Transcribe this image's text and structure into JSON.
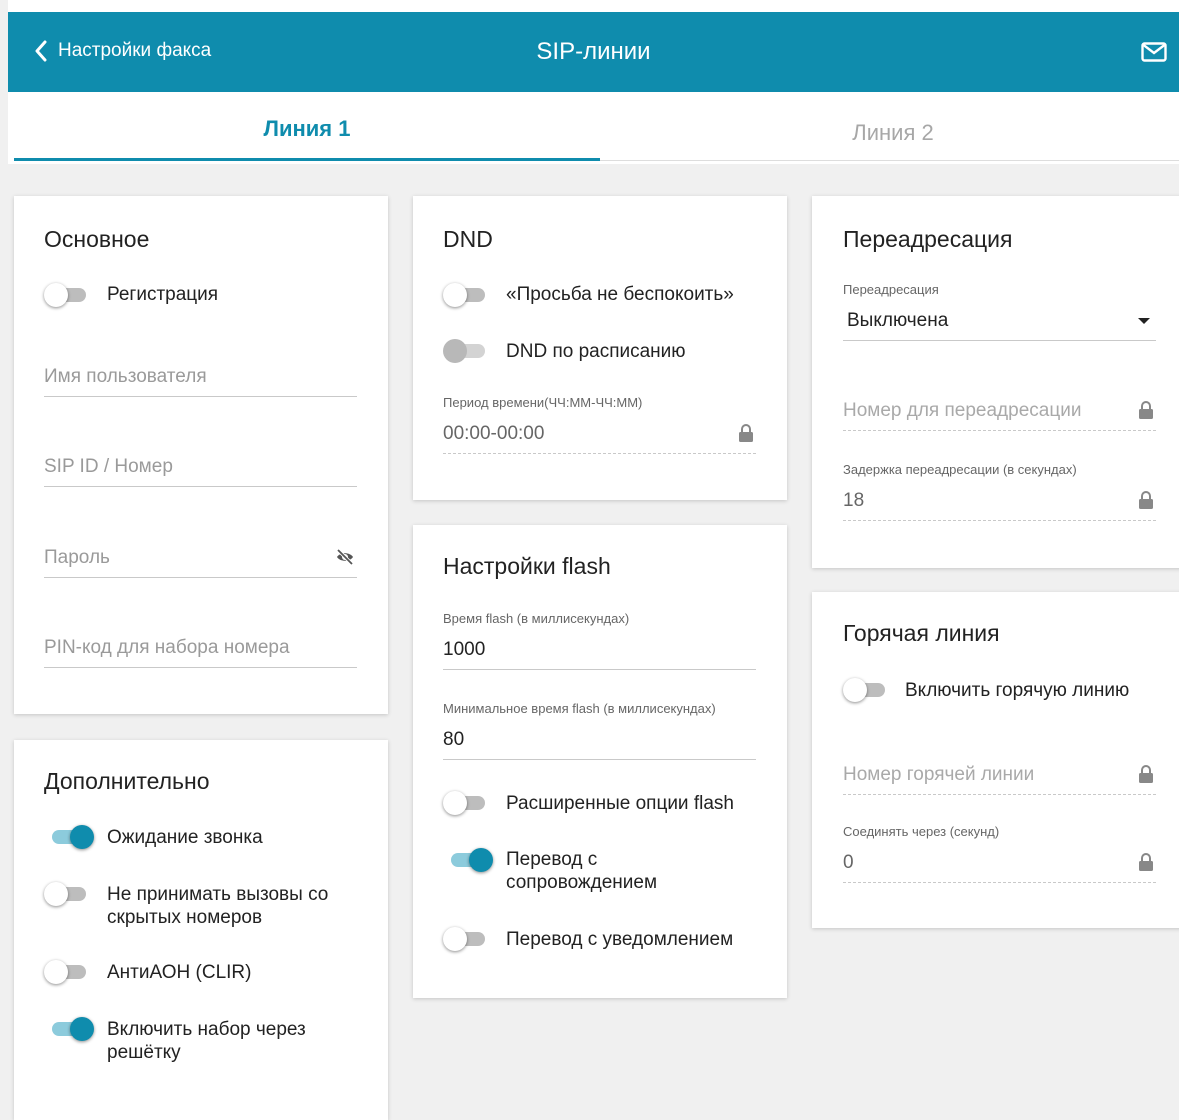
{
  "header": {
    "back_label": "Настройки факса",
    "title": "SIP-линии",
    "accent_color": "#0f8cad"
  },
  "tabs": [
    {
      "label": "Линия 1",
      "active": true
    },
    {
      "label": "Линия 2",
      "active": false
    }
  ],
  "basic": {
    "title": "Основное",
    "registration": {
      "label": "Регистрация",
      "on": false
    },
    "username": {
      "placeholder": "Имя пользователя"
    },
    "sip_id": {
      "placeholder": "SIP ID / Номер"
    },
    "password": {
      "placeholder": "Пароль"
    },
    "pin": {
      "placeholder": "PIN-код для набора номера"
    }
  },
  "extra": {
    "title": "Дополнительно",
    "call_waiting": {
      "label": "Ожидание звонка",
      "on": true
    },
    "reject_hidden": {
      "label_1": "Не принимать вызовы со",
      "label_2": "скрытых номеров",
      "on": false
    },
    "clir": {
      "label": "АнтиАОН (CLIR)",
      "on": false
    },
    "hash_dial": {
      "label_1": "Включить набор через",
      "label_2": "решётку",
      "on": true
    }
  },
  "dnd": {
    "title": "DND",
    "do_not_disturb": {
      "label": "«Просьба не беспокоить»",
      "on": false
    },
    "scheduled": {
      "label": "DND по расписанию",
      "on": false,
      "disabled": true
    },
    "period": {
      "label": "Период времени(ЧЧ:ММ-ЧЧ:ММ)",
      "value": "00:00-00:00"
    }
  },
  "flash": {
    "title": "Настройки flash",
    "time": {
      "label": "Время flash (в миллисекундах)",
      "value": "1000"
    },
    "min_time": {
      "label": "Минимальное время flash (в миллисекундах)",
      "value": "80"
    },
    "extended": {
      "label": "Расширенные опции flash",
      "on": false
    },
    "attended": {
      "label_1": "Перевод с",
      "label_2": "сопровождением",
      "on": true
    },
    "notify": {
      "label": "Перевод с уведомлением",
      "on": false
    }
  },
  "forward": {
    "title": "Переадресация",
    "mode": {
      "label": "Переадресация",
      "value": "Выключена"
    },
    "number": {
      "placeholder": "Номер для переадресации"
    },
    "delay": {
      "label": "Задержка переадресации (в секундах)",
      "value": "18"
    }
  },
  "hotline": {
    "title": "Горячая линия",
    "enable": {
      "label": "Включить горячую линию",
      "on": false
    },
    "number": {
      "placeholder": "Номер горячей линии"
    },
    "connect": {
      "label": "Соединять через (секунд)",
      "value": "0"
    }
  }
}
